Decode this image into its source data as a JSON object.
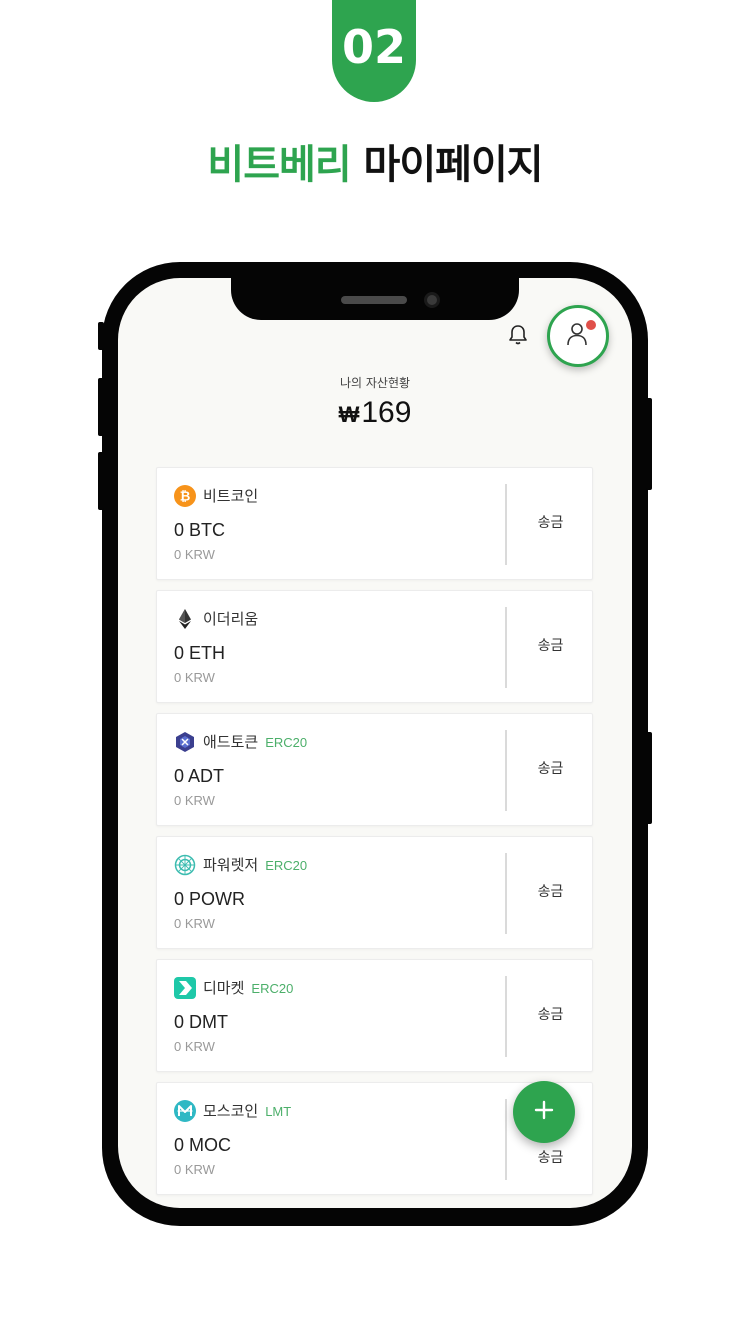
{
  "badge": "02",
  "headline": {
    "brand": "비트베리",
    "rest": " 마이페이지"
  },
  "summary": {
    "label": "나의 자산현황",
    "currency_symbol": "₩",
    "total": "169"
  },
  "header_icons": {
    "bell": "bell-icon",
    "profile": "user-icon"
  },
  "colors": {
    "brand_green": "#2ea44f",
    "tag_green": "#4caf6a",
    "notification_dot": "#e0504a"
  },
  "coins": [
    {
      "name": "비트코인",
      "tag": "",
      "amount": "0 BTC",
      "krw": "0 KRW",
      "send": "송금",
      "icon": "bitcoin-icon"
    },
    {
      "name": "이더리움",
      "tag": "",
      "amount": "0 ETH",
      "krw": "0 KRW",
      "send": "송금",
      "icon": "ethereum-icon"
    },
    {
      "name": "애드토큰",
      "tag": "ERC20",
      "amount": "0 ADT",
      "krw": "0 KRW",
      "send": "송금",
      "icon": "adtoken-icon"
    },
    {
      "name": "파워렛저",
      "tag": "ERC20",
      "amount": "0 POWR",
      "krw": "0 KRW",
      "send": "송금",
      "icon": "powerledger-icon"
    },
    {
      "name": "디마켓",
      "tag": "ERC20",
      "amount": "0 DMT",
      "krw": "0 KRW",
      "send": "송금",
      "icon": "dmarket-icon"
    },
    {
      "name": "모스코인",
      "tag": "LMT",
      "amount": "0 MOC",
      "krw": "0 KRW",
      "send": "송금",
      "icon": "moscoin-icon"
    }
  ],
  "fab": {
    "label": "+",
    "icon": "plus-icon"
  }
}
